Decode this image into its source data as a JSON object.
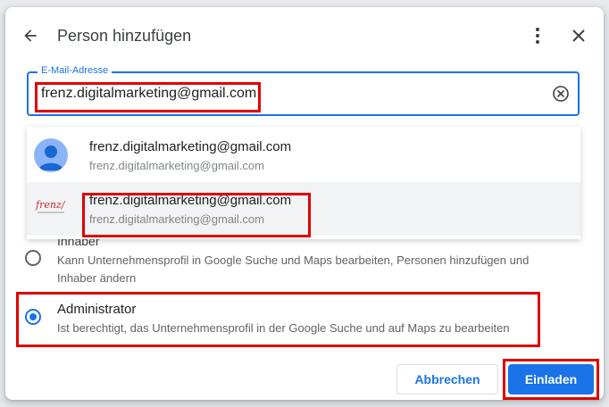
{
  "dialog": {
    "title": "Person hinzufügen"
  },
  "email_field": {
    "label": "E-Mail-Adresse",
    "value": "frenz.digitalmarketing@gmail.com"
  },
  "suggestions": [
    {
      "name": "frenz.digitalmarketing@gmail.com",
      "email": "frenz.digitalmarketing@gmail.com",
      "avatar": "default-person-avatar"
    },
    {
      "name": "frenz.digitalmarketing@gmail.com",
      "email": "frenz.digitalmarketing@gmail.com",
      "avatar": "frenz-logo",
      "logo_text": "frenz/"
    }
  ],
  "roles": [
    {
      "title": "Inhaber",
      "description": "Kann Unternehmensprofil in Google Suche und Maps bearbeiten, Personen hinzufügen und Inhaber ändern",
      "selected": false
    },
    {
      "title": "Administrator",
      "description": "Ist berechtigt, das Unternehmensprofil in der Google Suche und auf Maps zu bearbeiten",
      "selected": true
    }
  ],
  "actions": {
    "cancel_label": "Abbrechen",
    "invite_label": "Einladen"
  },
  "colors": {
    "accent": "#1a73e8",
    "highlight": "#e00000"
  }
}
